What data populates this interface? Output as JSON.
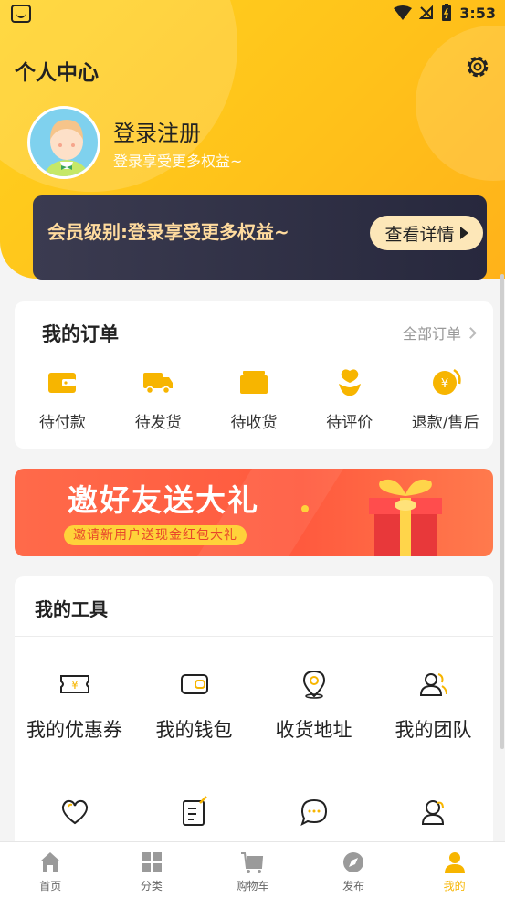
{
  "status_bar": {
    "time": "3:53"
  },
  "header": {
    "title": "个人中心"
  },
  "profile": {
    "login_title": "登录注册",
    "login_subtitle": "登录享受更多权益~"
  },
  "member": {
    "text": "会员级别:登录享受更多权益~",
    "button": "查看详情"
  },
  "orders": {
    "title": "我的订单",
    "all_label": "全部订单",
    "items": [
      {
        "label": "待付款",
        "icon": "wallet-icon"
      },
      {
        "label": "待发货",
        "icon": "truck-icon"
      },
      {
        "label": "待收货",
        "icon": "box-icon"
      },
      {
        "label": "待评价",
        "icon": "flower-icon"
      },
      {
        "label": "退款/售后",
        "icon": "refund-icon"
      }
    ]
  },
  "banner": {
    "title": "邀好友送大礼",
    "subtitle": "邀请新用户送现金红包大礼"
  },
  "tools": {
    "title": "我的工具",
    "items": [
      {
        "label": "我的优惠券",
        "icon": "coupon-icon"
      },
      {
        "label": "我的钱包",
        "icon": "wallet-icon"
      },
      {
        "label": "收货地址",
        "icon": "location-icon"
      },
      {
        "label": "我的团队",
        "icon": "team-icon"
      }
    ],
    "row2_icons": [
      "heart-icon",
      "edit-icon",
      "chat-icon",
      "service-icon"
    ]
  },
  "tabbar": {
    "items": [
      {
        "label": "首页",
        "icon": "home-icon"
      },
      {
        "label": "分类",
        "icon": "grid-icon"
      },
      {
        "label": "购物车",
        "icon": "cart-icon"
      },
      {
        "label": "发布",
        "icon": "compass-icon"
      },
      {
        "label": "我的",
        "icon": "user-icon"
      }
    ],
    "active": "我的"
  },
  "colors": {
    "accent": "#ffc21a",
    "icon": "#f7b500",
    "member_bg": "#2b2c40"
  }
}
